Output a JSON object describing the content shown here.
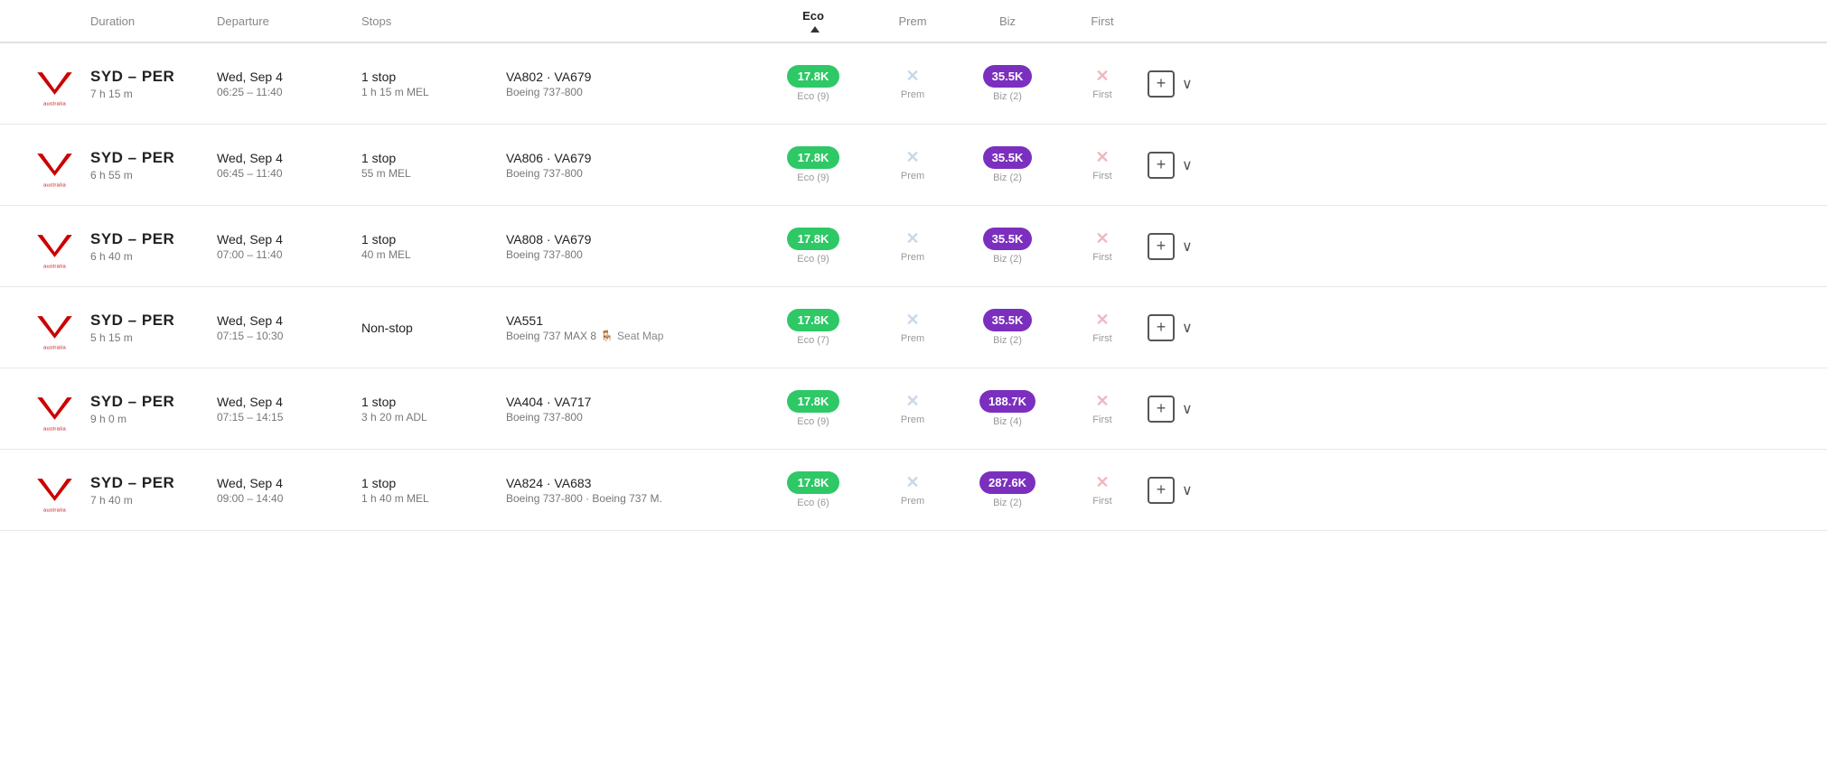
{
  "header": {
    "col_duration": "Duration",
    "col_departure": "Departure",
    "col_stops": "Stops",
    "col_eco": "Eco",
    "col_prem": "Prem",
    "col_biz": "Biz",
    "col_first": "First"
  },
  "flights": [
    {
      "id": 1,
      "route": "SYD – PER",
      "duration": "7 h 15 m",
      "departure_date": "Wed, Sep 4",
      "departure_time": "06:25 – 11:40",
      "stops": "1 stop",
      "stops_detail": "1 h 15 m MEL",
      "flight_codes": "VA802 · VA679",
      "aircraft": "Boeing 737-800",
      "eco_price": "17.8K",
      "eco_seats": "Eco (9)",
      "prem_available": false,
      "biz_price": "35.5K",
      "biz_seats": "Biz (2)",
      "first_available": false
    },
    {
      "id": 2,
      "route": "SYD – PER",
      "duration": "6 h 55 m",
      "departure_date": "Wed, Sep 4",
      "departure_time": "06:45 – 11:40",
      "stops": "1 stop",
      "stops_detail": "55 m MEL",
      "flight_codes": "VA806 · VA679",
      "aircraft": "Boeing 737-800",
      "eco_price": "17.8K",
      "eco_seats": "Eco (9)",
      "prem_available": false,
      "biz_price": "35.5K",
      "biz_seats": "Biz (2)",
      "first_available": false
    },
    {
      "id": 3,
      "route": "SYD – PER",
      "duration": "6 h 40 m",
      "departure_date": "Wed, Sep 4",
      "departure_time": "07:00 – 11:40",
      "stops": "1 stop",
      "stops_detail": "40 m MEL",
      "flight_codes": "VA808 · VA679",
      "aircraft": "Boeing 737-800",
      "eco_price": "17.8K",
      "eco_seats": "Eco (9)",
      "prem_available": false,
      "biz_price": "35.5K",
      "biz_seats": "Biz (2)",
      "first_available": false
    },
    {
      "id": 4,
      "route": "SYD – PER",
      "duration": "5 h 15 m",
      "departure_date": "Wed, Sep 4",
      "departure_time": "07:15 – 10:30",
      "stops": "Non-stop",
      "stops_detail": "",
      "flight_codes": "VA551",
      "aircraft": "Boeing 737 MAX 8",
      "has_seat_map": true,
      "eco_price": "17.8K",
      "eco_seats": "Eco (7)",
      "prem_available": false,
      "biz_price": "35.5K",
      "biz_seats": "Biz (2)",
      "first_available": false
    },
    {
      "id": 5,
      "route": "SYD – PER",
      "duration": "9 h 0 m",
      "departure_date": "Wed, Sep 4",
      "departure_time": "07:15 – 14:15",
      "stops": "1 stop",
      "stops_detail": "3 h 20 m ADL",
      "flight_codes": "VA404 · VA717",
      "aircraft": "Boeing 737-800",
      "eco_price": "17.8K",
      "eco_seats": "Eco (9)",
      "prem_available": false,
      "biz_price": "188.7K",
      "biz_seats": "Biz (4)",
      "first_available": false
    },
    {
      "id": 6,
      "route": "SYD – PER",
      "duration": "7 h 40 m",
      "departure_date": "Wed, Sep 4",
      "departure_time": "09:00 – 14:40",
      "stops": "1 stop",
      "stops_detail": "1 h 40 m MEL",
      "flight_codes": "VA824 · VA683",
      "aircraft": "Boeing 737-800 · Boeing 737 M.",
      "eco_price": "17.8K",
      "eco_seats": "Eco (6)",
      "prem_available": false,
      "biz_price": "287.6K",
      "biz_seats": "Biz (2)",
      "first_available": false
    }
  ],
  "labels": {
    "prem": "Prem",
    "first": "First",
    "seat_map": "Seat Map",
    "plus": "+",
    "chevron": "∨"
  }
}
